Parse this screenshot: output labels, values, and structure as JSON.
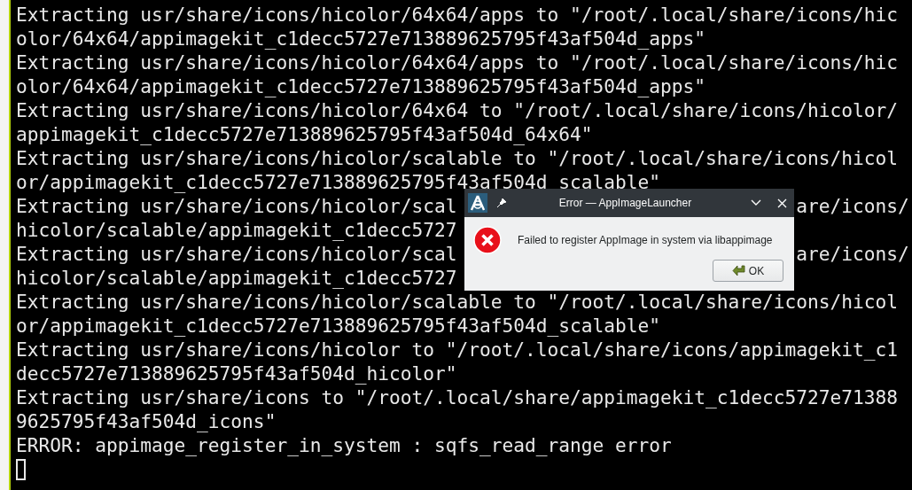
{
  "terminal": {
    "lines": [
      {
        "text": "Extracting usr/share/icons/hicolor/64x64/apps to \"/root/.local/share/icons/hic"
      },
      {
        "text": "olor/64x64/appimagekit_c1decc5727e713889625795f43af504d_apps\""
      },
      {
        "text": "Extracting usr/share/icons/hicolor/64x64/apps to \"/root/.local/share/icons/hic"
      },
      {
        "text": "olor/64x64/appimagekit_c1decc5727e713889625795f43af504d_apps\""
      },
      {
        "text": "Extracting usr/share/icons/hicolor/64x64 to \"/root/.local/share/icons/hicolor/"
      },
      {
        "text": "appimagekit_c1decc5727e713889625795f43af504d_64x64\""
      },
      {
        "text": "Extracting usr/share/icons/hicolor/scalable to \"/root/.local/share/icons/hicol"
      },
      {
        "text": "or/appimagekit_c1decc5727e713889625795f43af504d_scalable\""
      },
      {
        "text": "Extracting usr/share/icons/hicolor/scal",
        "right": "are/icons/"
      },
      {
        "text": "hicolor/scalable/appimagekit_c1decc5727"
      },
      {
        "text": "Extracting usr/share/icons/hicolor/scal",
        "right": "are/icons/"
      },
      {
        "text": "hicolor/scalable/appimagekit_c1decc5727"
      },
      {
        "text": "Extracting usr/share/icons/hicolor/scalable to \"/root/.local/share/icons/hicol"
      },
      {
        "text": "or/appimagekit_c1decc5727e713889625795f43af504d_scalable\""
      },
      {
        "text": "Extracting usr/share/icons/hicolor to \"/root/.local/share/icons/appimagekit_c1"
      },
      {
        "text": "decc5727e713889625795f43af504d_hicolor\""
      },
      {
        "text": "Extracting usr/share/icons to \"/root/.local/share/appimagekit_c1decc5727e71388"
      },
      {
        "text": "9625795f43af504d_icons\""
      },
      {
        "text": "ERROR: appimage_register_in_system : sqfs_read_range error"
      }
    ]
  },
  "dialog": {
    "title": "Error — AppImageLauncher",
    "message": "Failed to register AppImage in system via libappimage",
    "button": "OK"
  }
}
